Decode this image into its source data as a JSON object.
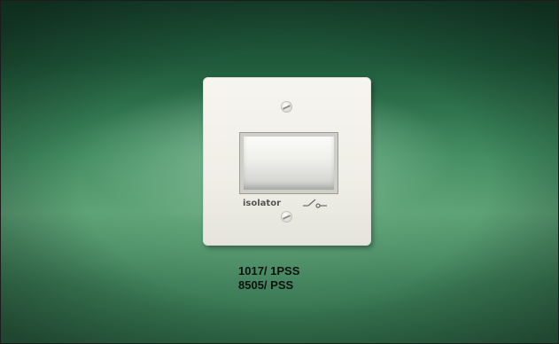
{
  "plate": {
    "label": "isolator"
  },
  "product_codes": [
    "1017/ 1PSS",
    "8505/ PSS"
  ],
  "colors": {
    "background": "#3f8a5f",
    "plate": "#f2f1ea",
    "text": "#111111"
  }
}
